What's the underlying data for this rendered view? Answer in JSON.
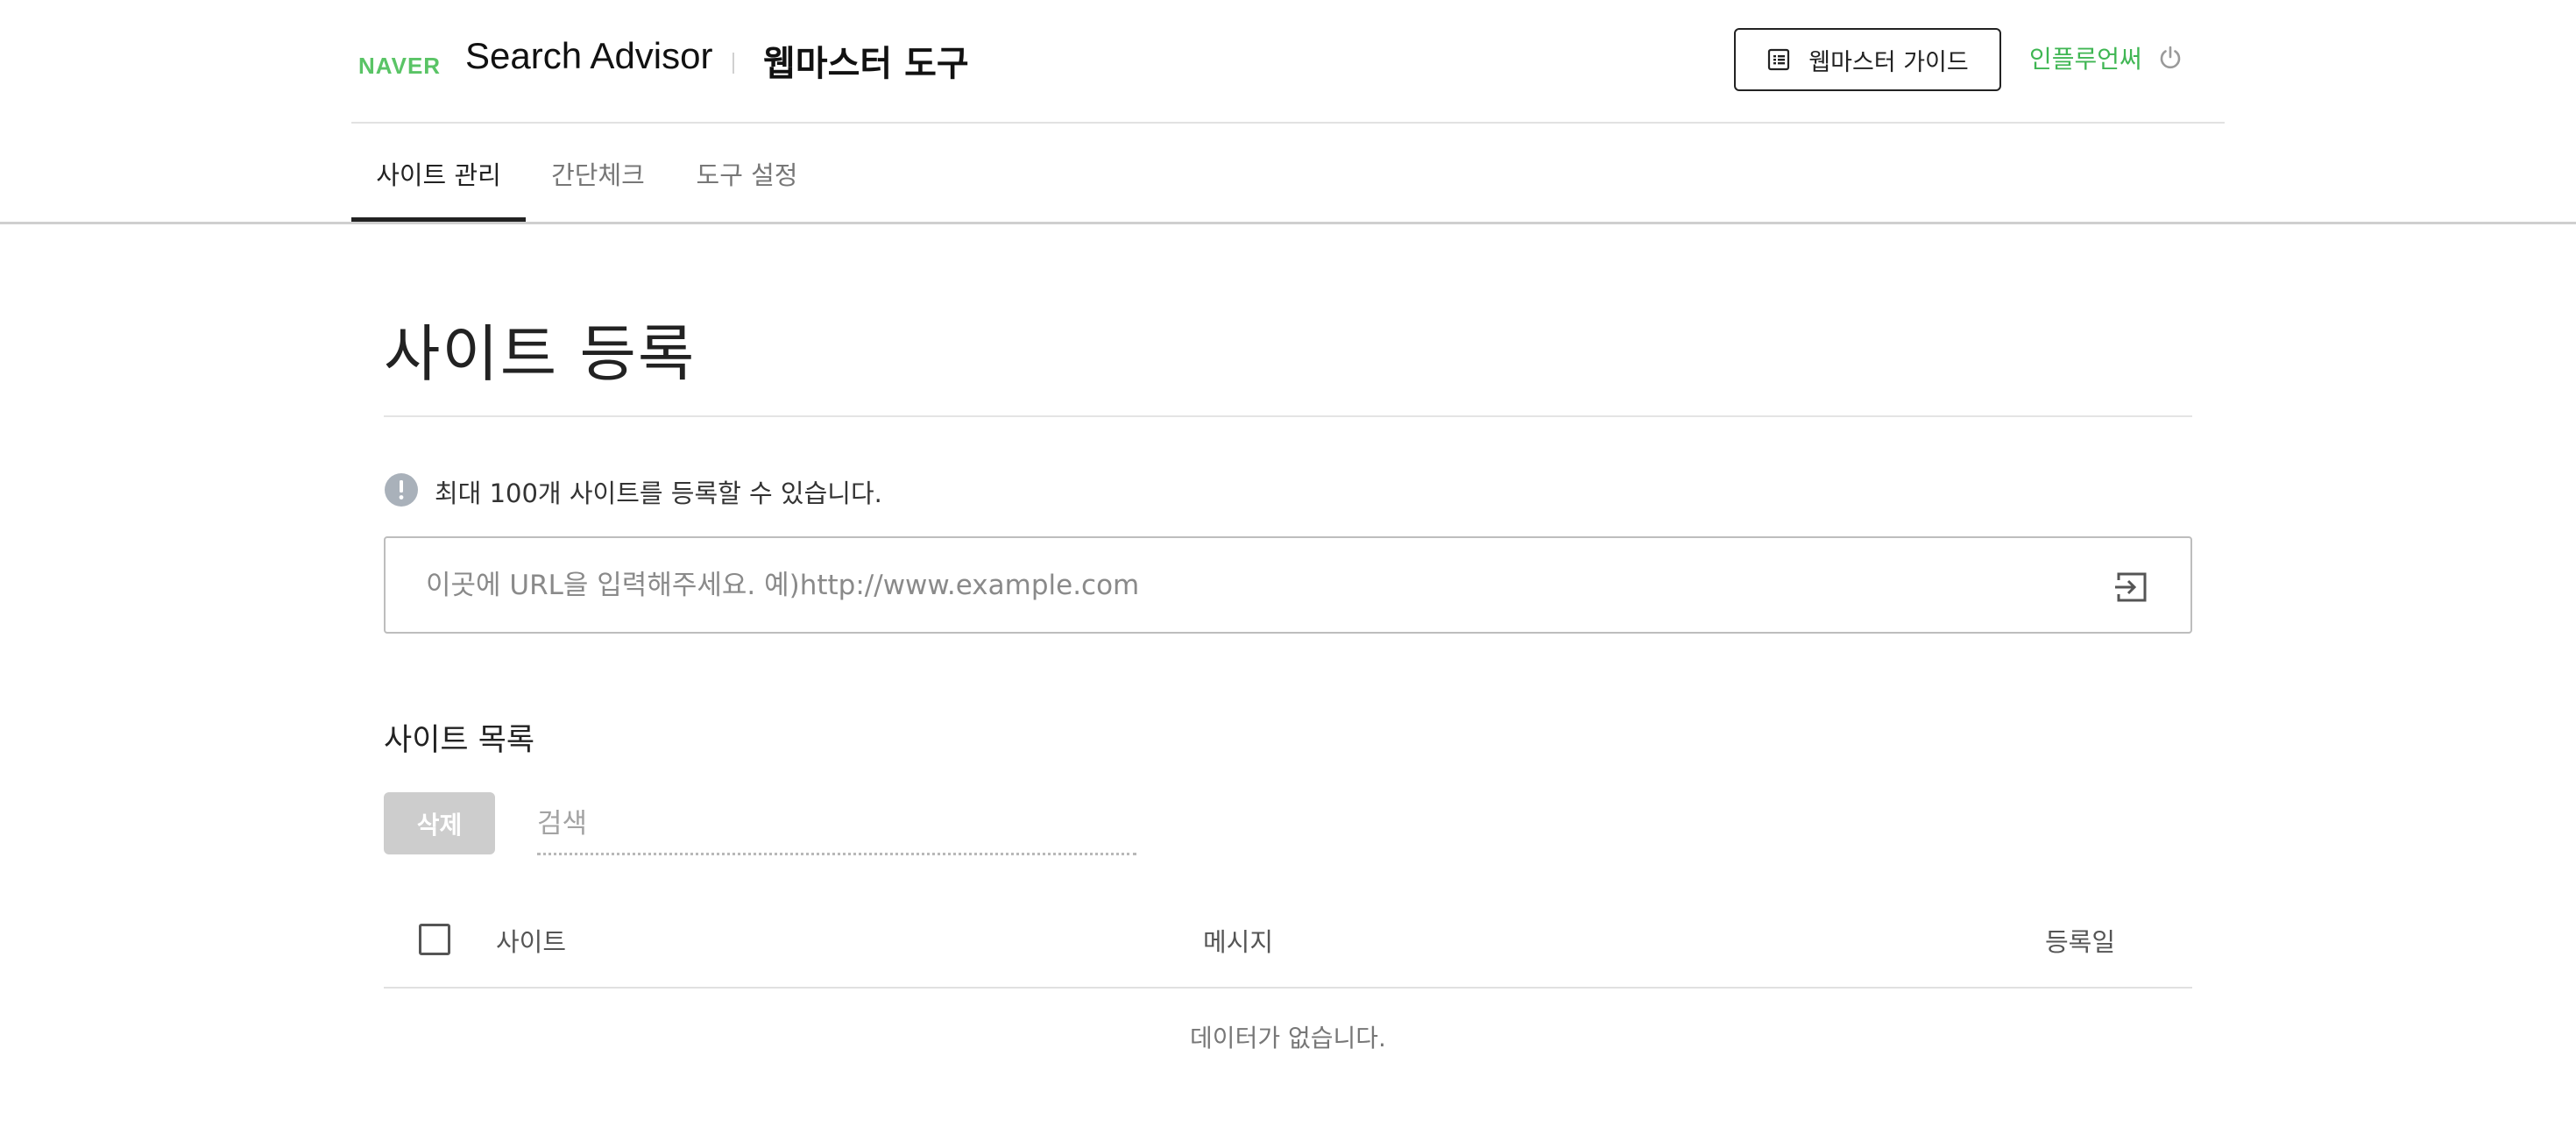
{
  "header": {
    "logo": "NAVER",
    "brand": "Search Advisor",
    "tool_title": "웹마스터 도구",
    "guide_button": "웹마스터 가이드",
    "user_name": "인플루언써",
    "guide_icon": "document-list-icon",
    "logout_icon": "power-icon"
  },
  "tabs": [
    {
      "label": "사이트 관리",
      "active": true
    },
    {
      "label": "간단체크",
      "active": false
    },
    {
      "label": "도구 설정",
      "active": false
    }
  ],
  "main": {
    "page_title": "사이트 등록",
    "notice": "최대 100개 사이트를 등록할 수 있습니다.",
    "notice_icon": "exclamation-icon",
    "url_input": {
      "value": "",
      "placeholder": "이곳에 URL을 입력해주세요. 예)http://www.example.com"
    },
    "submit_icon": "enter-icon",
    "list_title": "사이트 목록",
    "delete_button": "삭제",
    "search": {
      "value": "",
      "placeholder": "검색"
    },
    "table": {
      "columns": [
        "사이트",
        "메시지",
        "등록일"
      ],
      "rows": [],
      "empty_text": "데이터가 없습니다."
    }
  },
  "colors": {
    "accent_green": "#3fb653",
    "logo_green": "#5ac466",
    "disabled_button": "#cdcdcd"
  }
}
